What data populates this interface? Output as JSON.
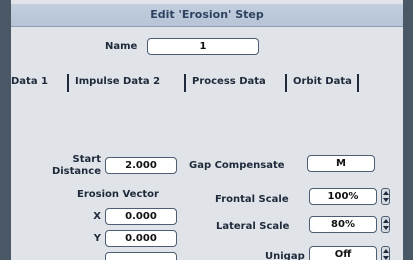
{
  "dialog": {
    "title": "Edit 'Erosion' Step",
    "name_label": "Name",
    "name_value": "1",
    "tabs": [
      "Data 1",
      "Impulse Data 2",
      "Process Data",
      "Orbit Data"
    ],
    "start_distance": {
      "label_line1": "Start",
      "label_line2": "Distance",
      "value": "2.000"
    },
    "erosion_vector": {
      "heading": "Erosion Vector",
      "x_label": "X",
      "x_value": "0.000",
      "y_label": "Y",
      "y_value": "0.000"
    },
    "gap_compensate": {
      "label": "Gap Compensate",
      "value": "M"
    },
    "frontal_scale": {
      "label": "Frontal Scale",
      "value": "100%"
    },
    "lateral_scale": {
      "label": "Lateral Scale",
      "value": "80%"
    },
    "unigap": {
      "label": "Unigap",
      "value": "Off"
    }
  }
}
